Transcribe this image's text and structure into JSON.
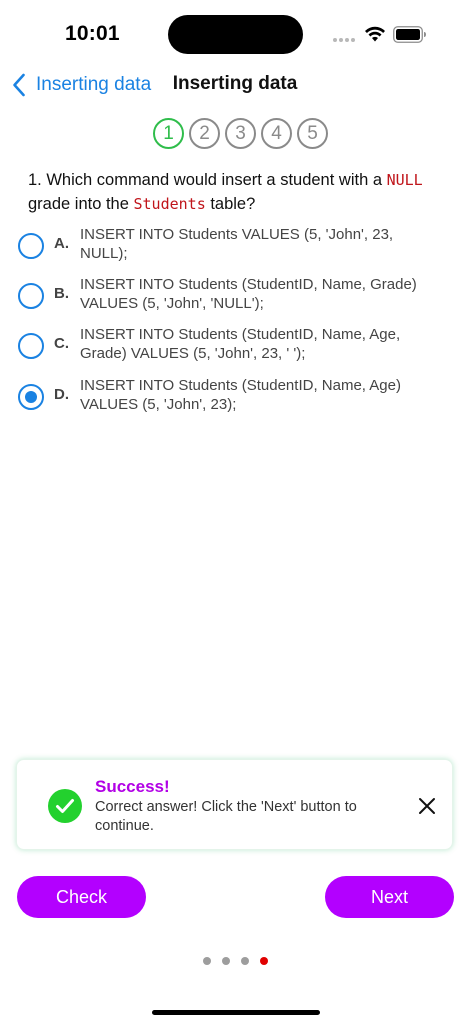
{
  "status_bar": {
    "time": "10:01"
  },
  "nav": {
    "back_label": "Inserting data",
    "title": "Inserting data"
  },
  "steps": [
    "1",
    "2",
    "3",
    "4",
    "5"
  ],
  "question": {
    "prefix": "1. Which command would insert a student with a ",
    "code1": "NULL",
    "middle": " grade into the ",
    "code2": "Students",
    "suffix": " table?"
  },
  "options": [
    {
      "letter": "A.",
      "text": "INSERT INTO Students VALUES (5, 'John', 23, NULL);",
      "selected": false
    },
    {
      "letter": "B.",
      "text": "INSERT INTO Students (StudentID, Name, Grade) VALUES (5, 'John', 'NULL');",
      "selected": false
    },
    {
      "letter": "C.",
      "text": "INSERT INTO Students (StudentID, Name, Age, Grade) VALUES (5, 'John', 23, ' ');",
      "selected": false
    },
    {
      "letter": "D.",
      "text": "INSERT INTO Students (StudentID, Name, Age) VALUES (5, 'John', 23);",
      "selected": true
    }
  ],
  "toast": {
    "title": "Success!",
    "message": "Correct answer! Click the 'Next' button to continue."
  },
  "buttons": {
    "check": "Check",
    "next": "Next"
  },
  "colors": {
    "accent_blue": "#1a82e2",
    "button_purple": "#b300ff",
    "success_green": "#23d12e",
    "step_active": "#2fbd4b",
    "code_red": "#c0151b",
    "page_dot_active": "#e00000"
  },
  "icons": {
    "back": "chevron-left-icon",
    "toast": "checkmark-circle-icon",
    "close": "close-icon"
  }
}
